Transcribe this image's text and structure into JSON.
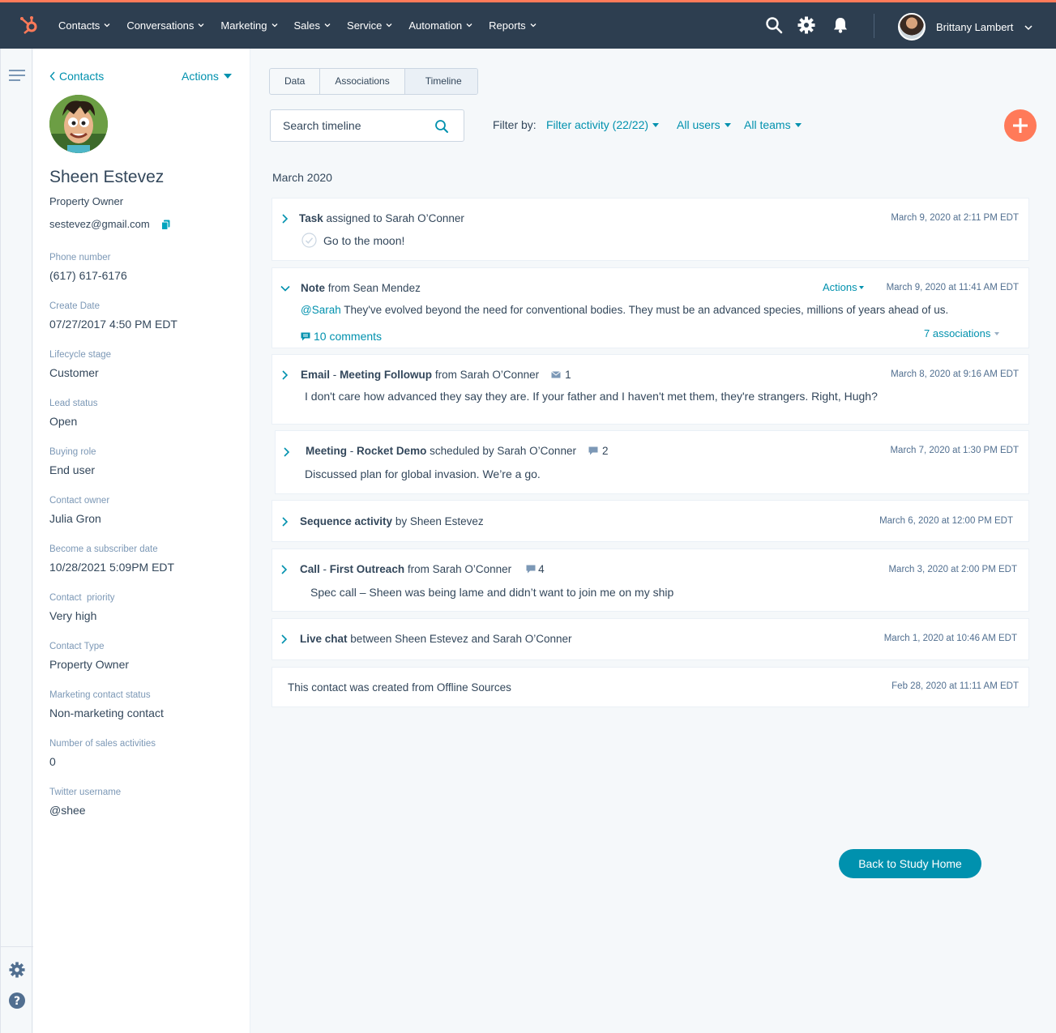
{
  "nav": {
    "items": [
      "Contacts",
      "Conversations",
      "Marketing",
      "Sales",
      "Service",
      "Automation",
      "Reports"
    ],
    "user_name": "Brittany Lambert"
  },
  "sidebar": {
    "back_label": "Contacts",
    "actions_label": "Actions",
    "name": "Sheen Estevez",
    "title": "Property Owner",
    "email": "sestevez@gmail.com",
    "properties": [
      {
        "label": "Phone number",
        "value": "(617) 617-6176"
      },
      {
        "label": "Create Date",
        "value": "07/27/2017 4:50 PM EDT"
      },
      {
        "label": "Lifecycle stage",
        "value": "Customer"
      },
      {
        "label": "Lead status",
        "value": "Open"
      },
      {
        "label": "Buying role",
        "value": "End user"
      },
      {
        "label": "Contact owner",
        "value": "Julia Gron"
      },
      {
        "label": "Become a subscriber date",
        "value": "10/28/2021 5:09PM EDT"
      },
      {
        "label": "Contact  priority",
        "value": "Very high"
      },
      {
        "label": "Contact Type",
        "value": "Property Owner"
      },
      {
        "label": "Marketing contact status",
        "value": "Non-marketing contact"
      },
      {
        "label": "Number of sales activities",
        "value": "0"
      },
      {
        "label": "Twitter username",
        "value": "@shee"
      }
    ]
  },
  "tabs": [
    "Data",
    "Associations",
    "Timeline"
  ],
  "search": {
    "placeholder": "Search timeline"
  },
  "filter": {
    "label": "Filter by:",
    "activity": "Filter activity (22/22)",
    "users": "All users",
    "teams": "All teams"
  },
  "month": "March 2020",
  "timeline": {
    "task": {
      "type": "Task",
      "rest": "assigned to Sarah O’Conner",
      "date": "March 9, 2020 at 2:11 PM EDT",
      "body": "Go to the moon!"
    },
    "note": {
      "type": "Note",
      "rest": "from Sean Mendez",
      "actions": "Actions",
      "date": "March 9, 2020 at 11:41 AM EDT",
      "mention": "@Sarah",
      "body": "They've evolved beyond the need for conventional bodies. They must be an advanced species, millions of years ahead of us.",
      "comments": "10 comments",
      "associations": "7 associations"
    },
    "email": {
      "type": "Email",
      "sep": "-",
      "subject": "Meeting Followup",
      "rest": "from Sarah O’Conner",
      "count": "1",
      "date": "March 8, 2020 at 9:16 AM EDT",
      "body": "I don't care how advanced they say they are. If your father and I haven't met them, they're strangers. Right, Hugh?"
    },
    "meeting": {
      "type": "Meeting",
      "sep": "-",
      "subject": "Rocket Demo",
      "rest": "scheduled by Sarah O’Conner",
      "count": "2",
      "date": "March 7, 2020 at 1:30 PM EDT",
      "body": "Discussed plan for global invasion. We’re a go."
    },
    "sequence": {
      "type": "Sequence activity",
      "rest": "by Sheen Estevez",
      "date": "March 6, 2020 at 12:00 PM EDT"
    },
    "call": {
      "type": "Call",
      "sep": "-",
      "subject": "First Outreach",
      "rest": "from Sarah O’Conner",
      "count": "4",
      "date": "March 3, 2020 at 2:00 PM EDT",
      "body": "Spec call – Sheen was being lame and didn’t want to join me on my ship"
    },
    "chat": {
      "type": "Live chat",
      "rest": "between Sheen Estevez and Sarah O’Conner",
      "date": "March 1, 2020 at 10:46 AM EDT"
    },
    "created": {
      "body": "This contact was created from Offline Sources",
      "date": "Feb 28, 2020 at 11:11 AM EDT"
    }
  },
  "back_home": "Back to Study Home",
  "colors": {
    "accent": "#0091ae",
    "brand": "#ff7a59",
    "nav": "#2d3e50"
  }
}
